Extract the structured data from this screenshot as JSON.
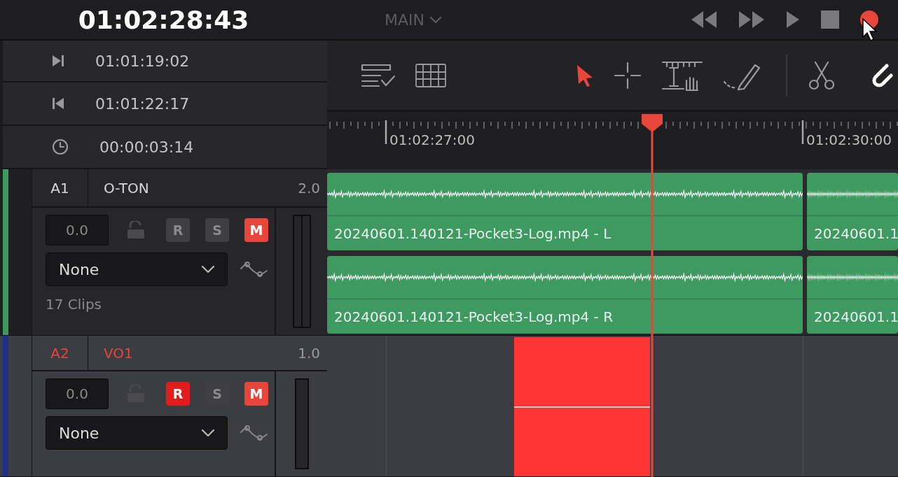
{
  "timecode": "01:02:28:43",
  "timeline_selector": {
    "label": "MAIN"
  },
  "transport": [
    {
      "kind": "rewind"
    },
    {
      "kind": "fast-forward"
    },
    {
      "kind": "play"
    },
    {
      "kind": "stop"
    },
    {
      "kind": "record"
    }
  ],
  "timecode_rows": [
    {
      "kind": "in",
      "value": "01:01:19:02"
    },
    {
      "kind": "out",
      "value": "01:01:22:17"
    },
    {
      "kind": "duration",
      "value": "00:00:03:14"
    }
  ],
  "view_tools": [
    {
      "kind": "edit-index"
    },
    {
      "kind": "grid"
    }
  ],
  "edit_modes": [
    {
      "kind": "select",
      "selected": true
    },
    {
      "kind": "crosshair",
      "selected": false
    },
    {
      "kind": "range",
      "selected": false
    },
    {
      "kind": "pencil",
      "selected": false
    }
  ],
  "toggles": [
    {
      "kind": "razor",
      "on": false
    },
    {
      "kind": "snap",
      "on": true
    }
  ],
  "ruler": {
    "labels": [
      "01:02:27:00",
      "01:02:30:00"
    ]
  },
  "tracks": [
    {
      "number": "A1",
      "name": "O-TON",
      "format": "2.0",
      "color": "#3f9a62",
      "selected": false,
      "armed": false,
      "buttons": [
        {
          "kind": "record",
          "label": "R",
          "on": false
        },
        {
          "kind": "solo",
          "label": "S",
          "on": false
        },
        {
          "kind": "mute",
          "label": "M",
          "on": true
        }
      ],
      "volume": "0.0",
      "effect": "None",
      "clip_count": "17 Clips",
      "kind": "stereo",
      "recording": false,
      "lanes": [
        {
          "clips": [
            "20240601.140121-Pocket3-Log.mp4 - L",
            "20240601.1"
          ]
        },
        {
          "clips": [
            "20240601.140121-Pocket3-Log.mp4 - R",
            "20240601.1"
          ]
        }
      ]
    },
    {
      "number": "A2",
      "name": "VO1",
      "format": "1.0",
      "color": "#1f2f8c",
      "selected": true,
      "armed": true,
      "buttons": [
        {
          "kind": "record",
          "label": "R",
          "on": true
        },
        {
          "kind": "solo",
          "label": "S",
          "on": false
        },
        {
          "kind": "mute",
          "label": "M",
          "on": true
        }
      ],
      "volume": "0.0",
      "effect": "None",
      "kind": "mono",
      "recording": true
    }
  ]
}
